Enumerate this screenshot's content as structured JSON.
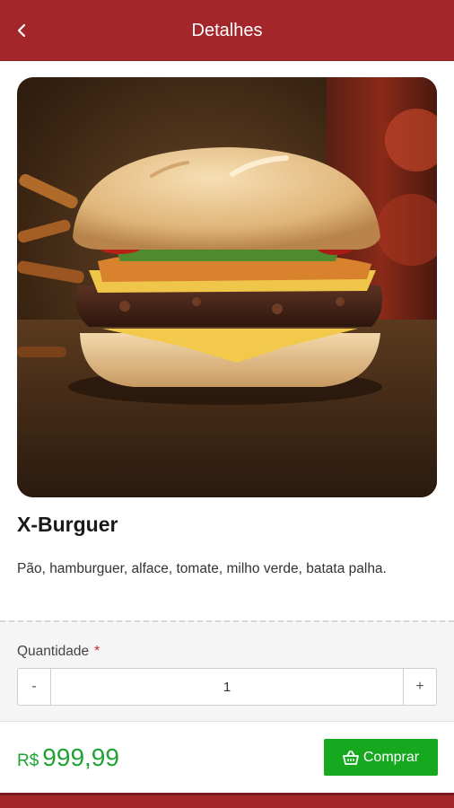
{
  "header": {
    "title": "Detalhes",
    "back_icon": "chevron-left-icon"
  },
  "product": {
    "name": "X-Burguer",
    "description": "Pão, hamburguer, alface, tomate, milho verde, batata palha.",
    "image": "burger-photo"
  },
  "quantity": {
    "label": "Quantidade",
    "required_mark": "*",
    "minus": "-",
    "value": "1",
    "plus": "+"
  },
  "footer": {
    "currency": "R$",
    "price": "999,99",
    "buy_label": "Comprar",
    "buy_icon": "shopping-basket-icon"
  },
  "colors": {
    "primary": "#a3262b",
    "price_green": "#1fa333",
    "button_green": "#16a81f"
  }
}
